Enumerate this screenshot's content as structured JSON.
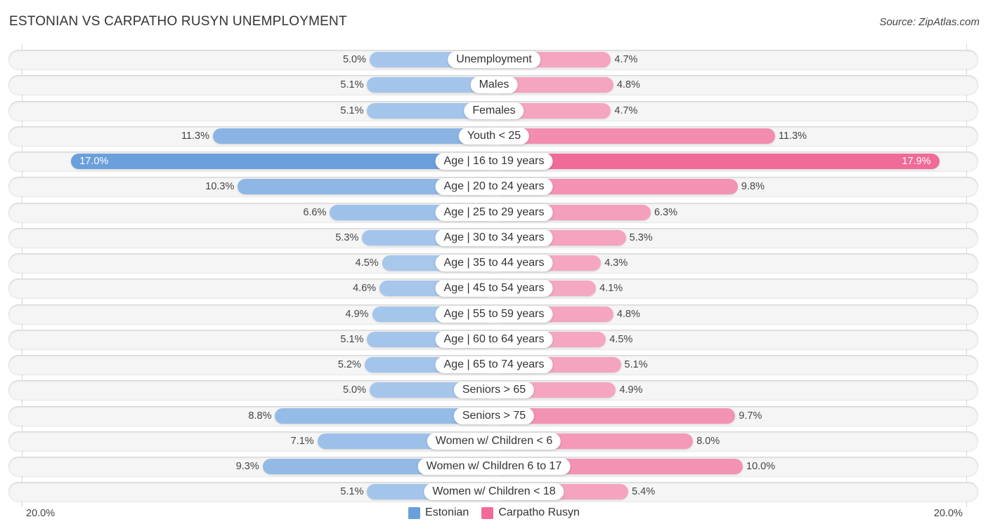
{
  "header": {
    "title": "ESTONIAN VS CARPATHO RUSYN UNEMPLOYMENT",
    "source": "Source: ZipAtlas.com"
  },
  "colors": {
    "estonian_strong": "#6a9fdc",
    "estonian_light": "#a9c8ec",
    "carpatho_strong": "#f06b97",
    "carpatho_light": "#f5a8c2"
  },
  "chart_data": {
    "type": "bar",
    "orientation": "horizontal-diverging",
    "title": "ESTONIAN VS CARPATHO RUSYN UNEMPLOYMENT",
    "xlabel": "",
    "ylabel": "",
    "unit": "%",
    "xlim": [
      -20.0,
      20.0
    ],
    "axis_labels": {
      "left": "20.0%",
      "right": "20.0%"
    },
    "legend": {
      "placement": "bottom-center",
      "entries": [
        "Estonian",
        "Carpatho Rusyn"
      ]
    },
    "categories": [
      "Unemployment",
      "Males",
      "Females",
      "Youth < 25",
      "Age | 16 to 19 years",
      "Age | 20 to 24 years",
      "Age | 25 to 29 years",
      "Age | 30 to 34 years",
      "Age | 35 to 44 years",
      "Age | 45 to 54 years",
      "Age | 55 to 59 years",
      "Age | 60 to 64 years",
      "Age | 65 to 74 years",
      "Seniors > 65",
      "Seniors > 75",
      "Women w/ Children < 6",
      "Women w/ Children 6 to 17",
      "Women w/ Children < 18"
    ],
    "series": [
      {
        "name": "Estonian",
        "side": "left",
        "values": [
          5.0,
          5.1,
          5.1,
          11.3,
          17.0,
          10.3,
          6.6,
          5.3,
          4.5,
          4.6,
          4.9,
          5.1,
          5.2,
          5.0,
          8.8,
          7.1,
          9.3,
          5.1
        ],
        "labels": [
          "5.0%",
          "5.1%",
          "5.1%",
          "11.3%",
          "17.0%",
          "10.3%",
          "6.6%",
          "5.3%",
          "4.5%",
          "4.6%",
          "4.9%",
          "5.1%",
          "5.2%",
          "5.0%",
          "8.8%",
          "7.1%",
          "9.3%",
          "5.1%"
        ]
      },
      {
        "name": "Carpatho Rusyn",
        "side": "right",
        "values": [
          4.7,
          4.8,
          4.7,
          11.3,
          17.9,
          9.8,
          6.3,
          5.3,
          4.3,
          4.1,
          4.8,
          4.5,
          5.1,
          4.9,
          9.7,
          8.0,
          10.0,
          5.4
        ],
        "labels": [
          "4.7%",
          "4.8%",
          "4.7%",
          "11.3%",
          "17.9%",
          "9.8%",
          "6.3%",
          "5.3%",
          "4.3%",
          "4.1%",
          "4.8%",
          "4.5%",
          "5.1%",
          "4.9%",
          "9.7%",
          "8.0%",
          "10.0%",
          "5.4%"
        ]
      }
    ],
    "grid": false
  }
}
